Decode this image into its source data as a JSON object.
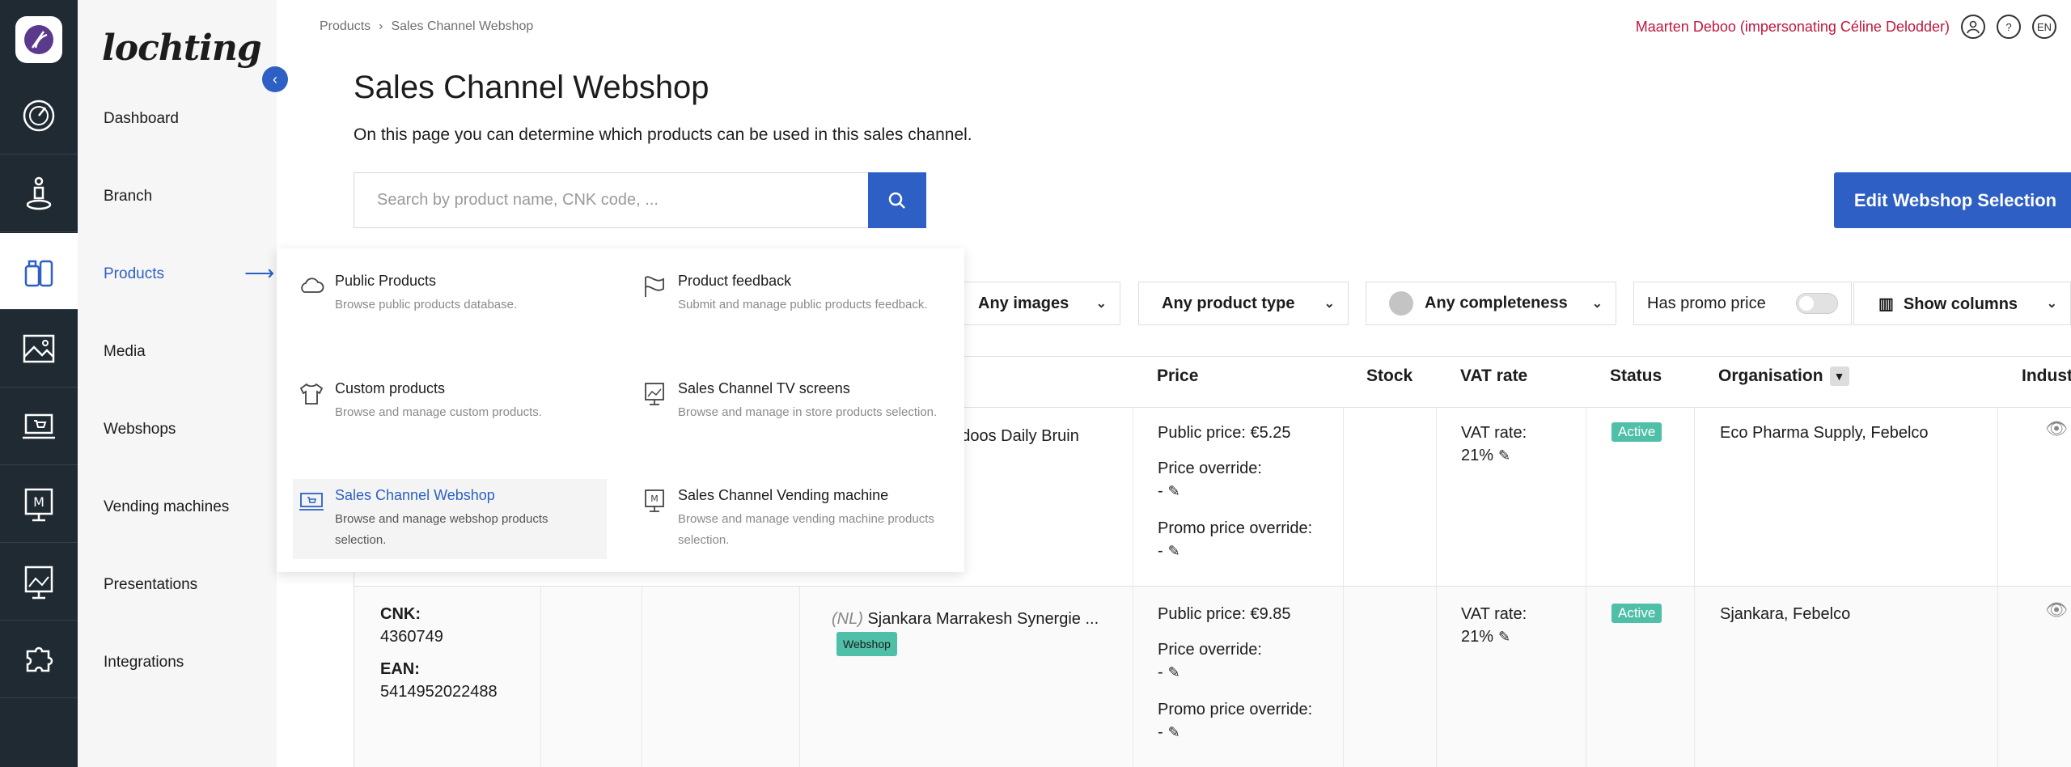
{
  "brand": "lochting",
  "nav": {
    "items": [
      "Dashboard",
      "Branch",
      "Products",
      "Media",
      "Webshops",
      "Vending machines",
      "Presentations",
      "Integrations"
    ],
    "active_index": 2
  },
  "breadcrumb": [
    "Products",
    "Sales Channel Webshop"
  ],
  "topbar": {
    "impersonation": "Maarten Deboo (impersonating Céline Delodder)",
    "help": "?",
    "language": "EN"
  },
  "page": {
    "title": "Sales Channel Webshop",
    "subtitle": "On this page you can determine which products can be used in this sales channel.",
    "search_placeholder": "Search by product name, CNK code, ...",
    "edit_button": "Edit Webshop Selection"
  },
  "filters": {
    "images": "Any images",
    "product_type": "Any product type",
    "completeness": "Any completeness",
    "promo": "Has promo price",
    "columns": "Show columns"
  },
  "mega_menu": [
    {
      "title": "Public Products",
      "desc": "Browse public products database.",
      "icon": "cloud-icon"
    },
    {
      "title": "Product feedback",
      "desc": "Submit and manage public products feedback.",
      "icon": "flag-icon"
    },
    {
      "title": "Custom products",
      "desc": "Browse and manage custom products.",
      "icon": "shirt-icon"
    },
    {
      "title": "Sales Channel TV screens",
      "desc": "Browse and manage in store products selection.",
      "icon": "tv-screen-icon"
    },
    {
      "title": "Sales Channel Webshop",
      "desc": "Browse and manage webshop products selection.",
      "icon": "webshop-icon"
    },
    {
      "title": "Sales Channel Vending machine",
      "desc": "Browse and manage vending machine products selection.",
      "icon": "vending-machine-icon"
    }
  ],
  "table": {
    "headers": {
      "price": "Price",
      "stock": "Stock",
      "vat": "VAT rate",
      "status": "Status",
      "organisation": "Organisation",
      "industry": "Indust"
    },
    "rows": [
      {
        "name": "endoos Daily Bruin",
        "public_price": "Public price: €5.25",
        "price_override_label": "Price override:",
        "price_override": "-",
        "promo_override_label": "Promo price override:",
        "promo_override": "-",
        "vat_label": "VAT rate:",
        "vat": "21%",
        "status": "Active",
        "organisation": "Eco Pharma Supply, Febelco"
      },
      {
        "cnk_label": "CNK:",
        "cnk": "4360749",
        "ean_label": "EAN:",
        "ean": "5414952022488",
        "lang": "(NL)",
        "name": "Sjankara Marrakesh Synergie ...",
        "tag": "Webshop",
        "public_price": "Public price: €9.85",
        "price_override_label": "Price override:",
        "price_override": "-",
        "promo_override_label": "Promo price override:",
        "promo_override": "-",
        "vat_label": "VAT rate:",
        "vat": "21%",
        "status": "Active",
        "organisation": "Sjankara, Febelco"
      }
    ]
  },
  "colors": {
    "accent": "#2d5fc4",
    "rail": "#1f2a33",
    "active_badge": "#4fbfa8",
    "impersonation": "#c0173f"
  }
}
